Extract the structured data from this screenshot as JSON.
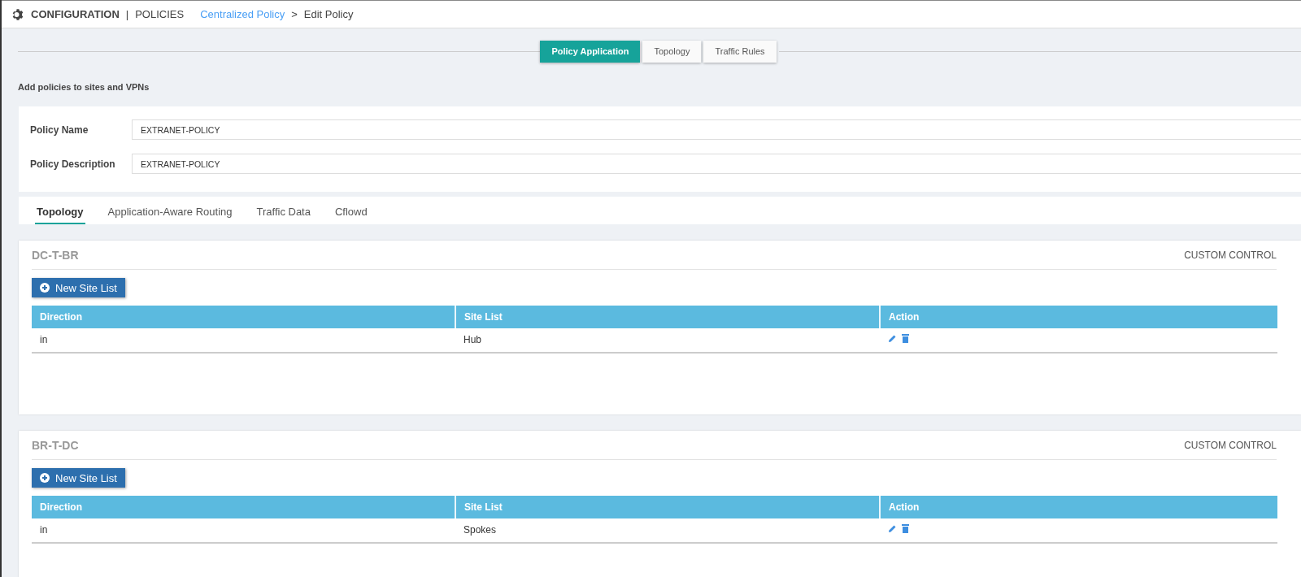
{
  "header": {
    "section": "CONFIGURATION",
    "divider": "|",
    "subsection": "POLICIES",
    "breadcrumb_link": "Centralized Policy",
    "separator": ">",
    "breadcrumb_current": "Edit Policy"
  },
  "steps": [
    {
      "label": "Policy Application",
      "selected": true
    },
    {
      "label": "Topology",
      "selected": false
    },
    {
      "label": "Traffic Rules",
      "selected": false
    }
  ],
  "intro": "Add policies to sites and VPNs",
  "form": [
    {
      "label": "Policy Name",
      "value": "EXTRANET-POLICY"
    },
    {
      "label": "Policy Description",
      "value": "EXTRANET-POLICY"
    }
  ],
  "tabs": [
    {
      "label": "Topology",
      "selected": true
    },
    {
      "label": "Application-Aware Routing",
      "selected": false
    },
    {
      "label": "Traffic Data",
      "selected": false
    },
    {
      "label": "Cflowd",
      "selected": false
    }
  ],
  "cards": [
    {
      "title": "DC-T-BR",
      "type": "CUSTOM CONTROL",
      "button": "New Site List",
      "columns": [
        "Direction",
        "Site List",
        "Action"
      ],
      "rows": [
        {
          "direction": "in",
          "site_list": "Hub"
        }
      ]
    },
    {
      "title": "BR-T-DC",
      "type": "CUSTOM CONTROL",
      "button": "New Site List",
      "columns": [
        "Direction",
        "Site List",
        "Action"
      ],
      "rows": [
        {
          "direction": "in",
          "site_list": "Spokes"
        }
      ]
    }
  ]
}
